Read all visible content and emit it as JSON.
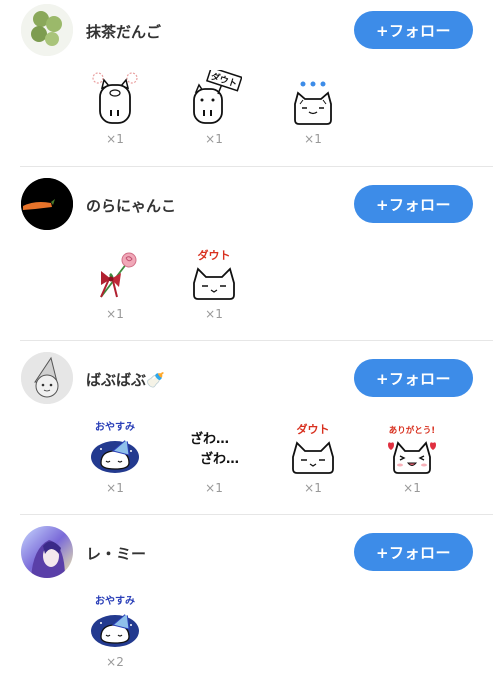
{
  "follow_label": "+フォロー",
  "accent": "#3d8ce8",
  "users": [
    {
      "name": "抹茶だんご",
      "stamps": [
        {
          "icon": "cat-sweat-icon",
          "count": "×1"
        },
        {
          "icon": "cat-doubt-sign-icon",
          "sign": "ダウト",
          "count": "×1"
        },
        {
          "icon": "cat-dots-icon",
          "count": "×1"
        }
      ]
    },
    {
      "name": "のらにゃんこ",
      "stamps": [
        {
          "icon": "rose-ribbon-icon",
          "count": "×1"
        },
        {
          "icon": "cat-doubt-icon",
          "caption": "ダウト",
          "count": "×1"
        }
      ]
    },
    {
      "name": "ばぶばぶ🍼",
      "stamps": [
        {
          "icon": "cat-goodnight-icon",
          "caption": "おやすみ",
          "count": "×1"
        },
        {
          "icon": "zawa-zawa-text-icon",
          "line1": "ざわ…",
          "line2": "ざわ…",
          "count": "×1"
        },
        {
          "icon": "cat-doubt-icon",
          "caption": "ダウト",
          "count": "×1"
        },
        {
          "icon": "cat-thanks-icon",
          "caption": "ありがとう!",
          "count": "×1"
        }
      ]
    },
    {
      "name": "レ・ミー",
      "stamps": [
        {
          "icon": "cat-goodnight-icon",
          "caption": "おやすみ",
          "count": "×2"
        }
      ]
    }
  ]
}
